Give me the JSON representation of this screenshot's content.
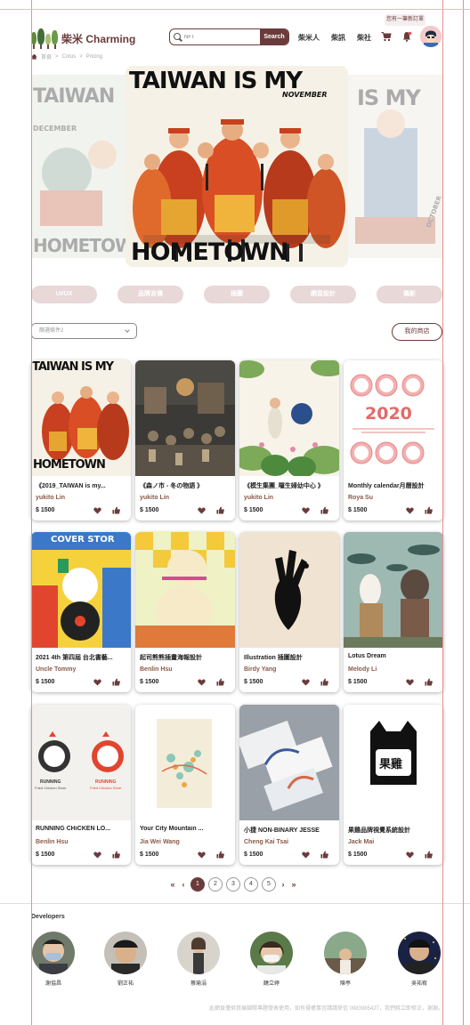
{
  "top_badge": "您有一筆新訂單",
  "brand": {
    "name": "柴米 Charming"
  },
  "search": {
    "placeholder": "NFT",
    "button": "Search"
  },
  "nav": {
    "items": [
      "柴米人",
      "柴訊",
      "柴社"
    ]
  },
  "breadcrumb": [
    "首頁",
    "Cotus",
    "Pricing"
  ],
  "carousel": {
    "main_title_top": "TAIWAN IS MY",
    "main_subtitle": "NOVEMBER",
    "main_title_bottom": "HOMETOWN",
    "left_title_top": "TAIWAN",
    "left_subtitle": "DECEMBER",
    "left_title_bottom": "HOMETOWN",
    "right_title_top": "IS MY",
    "right_subtitle": "OCTOBER"
  },
  "categories": [
    "UI/UX",
    "品牌言傳",
    "插圖",
    "網頁設計",
    "攝影"
  ],
  "filter": {
    "placeholder": "篩選條件2"
  },
  "my_shop": "我的商店",
  "products": [
    {
      "title": "《2019_TAIWAN is my...",
      "author": "yukito Lin",
      "price": "$ 1500"
    },
    {
      "title": "《森ノ市 - 冬の物語 》",
      "author": "yukito Lin",
      "price": "$ 1500"
    },
    {
      "title": "《模生集團_囉生婦幼中心 》",
      "author": "yukito Lin",
      "price": "$ 1500"
    },
    {
      "title": "Monthly calendar月曆設計",
      "author": "Roya Su",
      "price": "$ 1500"
    },
    {
      "title": "2021 4th 第四屆 台北書藝...",
      "author": "Uncle Tommy",
      "price": "$ 1500"
    },
    {
      "title": "起司熊熊插畫海報設計",
      "author": "Benlin Hsu",
      "price": "$ 1500"
    },
    {
      "title": "Illustration  插圖設計",
      "author": "Birdy Yang",
      "price": "$ 1500"
    },
    {
      "title": "Lotus Dream",
      "author": "Melody Li",
      "price": "$ 1500"
    },
    {
      "title": "RUNNING CHiCKEN LO...",
      "author": "Benlin Hsu",
      "price": "$ 1500"
    },
    {
      "title": "Your City Mountain ...",
      "author": "Jia Wei Wang",
      "price": "$ 1500"
    },
    {
      "title": "小捷 NON-BINARY JESSE",
      "author": "Cheng Kai Tsai",
      "price": "$ 1500"
    },
    {
      "title": "果雞品牌視覺系統設計",
      "author": "Jack Mai",
      "price": "$ 1500"
    }
  ],
  "card_art": {
    "calendar_year": "2020",
    "chicken_label": "RUNNING",
    "chicken_sub": "Fried Chicken Store",
    "comic_title": "COVER STOR",
    "logo_text": "果雞"
  },
  "pagination": {
    "pages": [
      "1",
      "2",
      "3",
      "4",
      "5"
    ],
    "current": "1",
    "first": "«",
    "prev": "‹",
    "next": "›",
    "last": "»"
  },
  "developers": {
    "title": "Developers",
    "people": [
      "謝協昌",
      "劉正祐",
      "蔡瑜涓",
      "饒立婷",
      "陳亭",
      "吳祐宥"
    ]
  },
  "footer_note": "此網頁僅供資展國際專題發表使用，如有侵權事宜請請來信 0983985427，我們將立即修正，謝謝。",
  "colors": {
    "brand": "#6b3b3b",
    "pill": "#e8d8d8",
    "guide": "#e98f8f"
  }
}
